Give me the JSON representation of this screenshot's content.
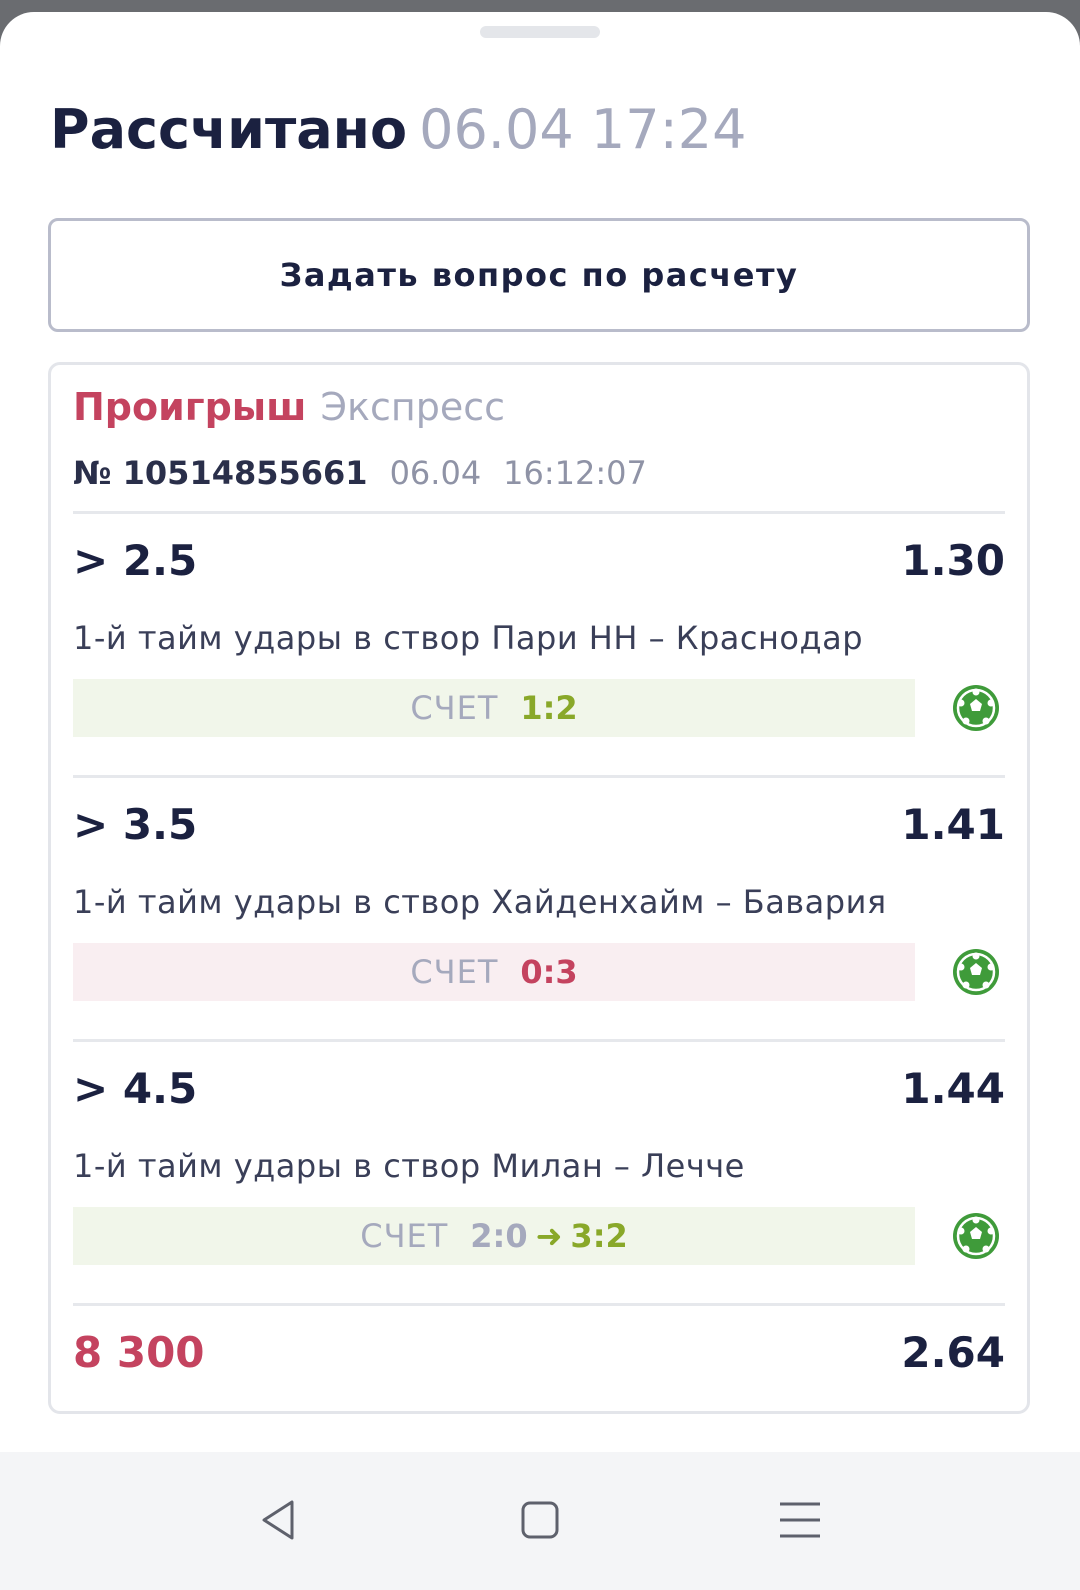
{
  "header": {
    "title": "Рассчитано",
    "datetime": "06.04 17:24"
  },
  "ask_button": {
    "label": "Задать вопрос по расчету"
  },
  "bet_card": {
    "status": "Проигрыш",
    "type": "Экспресс",
    "number": "№ 10514855661",
    "date": "06.04",
    "time": "16:12:07",
    "selections": [
      {
        "outcome": "> 2.5",
        "odds": "1.30",
        "description": "1-й тайм удары в створ Пари НН – Краснодар",
        "score_label": "СЧЕТ",
        "score": "1:2",
        "result": "win",
        "icon": "soccer-ball-icon"
      },
      {
        "outcome": "> 3.5",
        "odds": "1.41",
        "description": "1-й тайм удары в створ Хайденхайм – Бавария",
        "score_label": "СЧЕТ",
        "score": "0:3",
        "result": "lose",
        "icon": "soccer-ball-icon"
      },
      {
        "outcome": "> 4.5",
        "odds": "1.44",
        "description": "1-й тайм удары в створ Милан – Лечче",
        "score_label": "СЧЕТ",
        "score_from": "2:0",
        "score_to": "3:2",
        "result": "win",
        "icon": "soccer-ball-icon"
      }
    ],
    "stake": "8 300",
    "total_odds": "2.64"
  },
  "colors": {
    "accent_red": "#c4435f",
    "accent_green": "#89a829",
    "ball_green": "#3f9b3a",
    "text_dark": "#1b2140",
    "text_muted": "#a5a9bd"
  },
  "navbar": {
    "icons": [
      "back-triangle-icon",
      "home-square-icon",
      "menu-lines-icon"
    ]
  }
}
